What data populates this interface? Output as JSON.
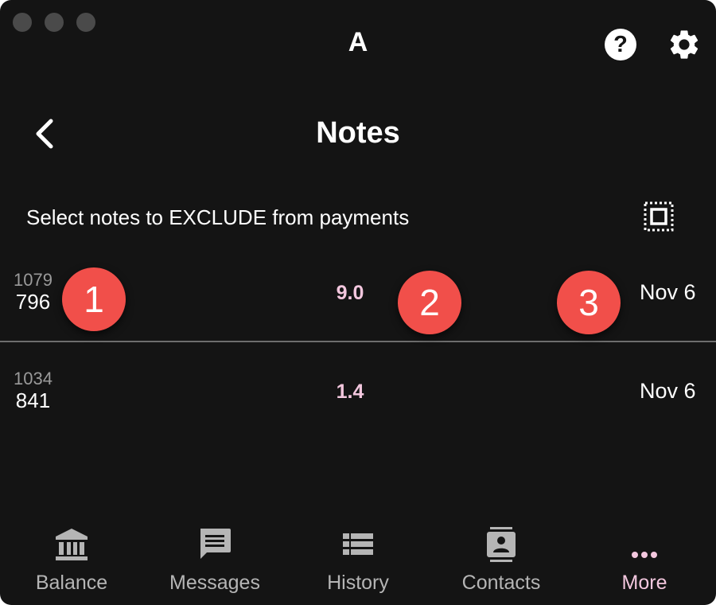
{
  "app": {
    "title": "A"
  },
  "header": {
    "title": "Notes"
  },
  "instruction": "Select notes to EXCLUDE from payments",
  "notes": [
    {
      "id_top": "1079",
      "id_bottom": "796",
      "amount": "9.0",
      "date": "Nov 6"
    },
    {
      "id_top": "1034",
      "id_bottom": "841",
      "amount": "1.4",
      "date": "Nov 6"
    }
  ],
  "badges": [
    "1",
    "2",
    "3"
  ],
  "nav": [
    {
      "label": "Balance",
      "icon": "bank-icon"
    },
    {
      "label": "Messages",
      "icon": "message-icon"
    },
    {
      "label": "History",
      "icon": "list-icon"
    },
    {
      "label": "Contacts",
      "icon": "contacts-icon"
    },
    {
      "label": "More",
      "icon": "more-icon",
      "active": true
    }
  ],
  "colors": {
    "background": "#141414",
    "accent": "#f3c7de",
    "badge": "#f14f4a",
    "nav_inactive": "#b5b5b5"
  }
}
